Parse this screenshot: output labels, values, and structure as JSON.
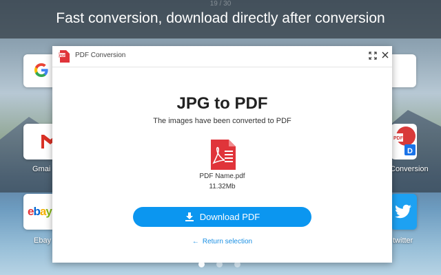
{
  "banner": {
    "counter": "19 / 30",
    "headline": "Fast conversion, download directly after conversion"
  },
  "tiles": {
    "gmail_label": "Gmai",
    "ebay_label": "Ebay",
    "conversion_label": "Conversion",
    "twitter_label": "twitter",
    "ebay_logo": "ebay",
    "google_logo": "G"
  },
  "modal": {
    "title": "PDF Conversion",
    "heading": "JPG to PDF",
    "subtitle": "The images have been converted to PDF",
    "file_name": "PDF Name.pdf",
    "file_size": "11.32Mb",
    "download_label": "Download PDF",
    "return_label": "Return selection"
  },
  "icons": {
    "expand": "expand-icon",
    "close": "close-icon",
    "file": "pdf-file-icon",
    "download": "download-icon",
    "back": "arrow-left-icon"
  },
  "colors": {
    "accent": "#0b96f0",
    "link": "#1a8fe3",
    "pdf_red": "#e0343a"
  },
  "pagination": {
    "total": 3,
    "active": 1
  }
}
